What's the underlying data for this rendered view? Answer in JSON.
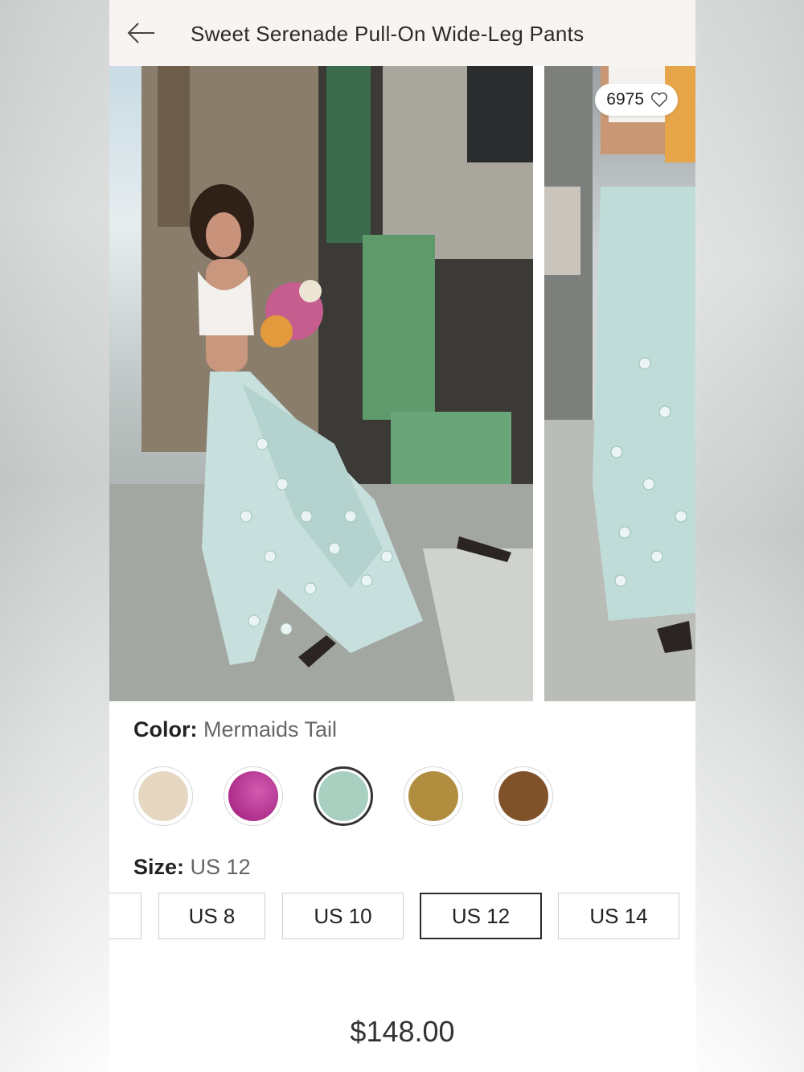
{
  "header": {
    "title": "Sweet Serenade Pull-On Wide-Leg Pants"
  },
  "gallery": {
    "likes_count": "6975"
  },
  "color": {
    "label": "Color:",
    "selected": "Mermaids Tail",
    "swatches": [
      {
        "name": "cream",
        "hex": "#e6d7c3"
      },
      {
        "name": "magenta",
        "hex": "#b12a8e"
      },
      {
        "name": "mermaids-tail",
        "hex": "#a9cfc0",
        "selected": true
      },
      {
        "name": "gold",
        "hex": "#b18d3f"
      },
      {
        "name": "brown",
        "hex": "#80522a"
      }
    ]
  },
  "size": {
    "label": "Size:",
    "selected": "US 12",
    "options": [
      "US 8",
      "US 10",
      "US 12",
      "US 14"
    ]
  },
  "price": "$148.00",
  "colors": {
    "accent": "#2b2b2b",
    "header_bg": "#f8f4f1"
  }
}
